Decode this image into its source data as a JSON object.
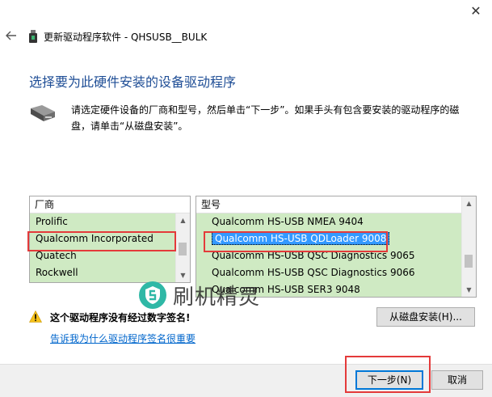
{
  "window": {
    "title": "更新驱动程序软件 - QHSUSB__BULK",
    "close_glyph": "✕"
  },
  "main": {
    "heading": "选择要为此硬件安装的设备驱动程序",
    "instruction": "请选定硬件设备的厂商和型号，然后单击“下一步”。如果手头有包含要安装的驱动程序的磁盘，请单击“从磁盘安装”。"
  },
  "manufacturers": {
    "header": "厂商",
    "items": [
      "Prolific",
      "Qualcomm Incorporated",
      "Quatech",
      "Rockwell"
    ]
  },
  "models": {
    "header": "型号",
    "items": [
      "Qualcomm HS-USB NMEA 9404",
      "Qualcomm HS-USB QDLoader 9008",
      "Qualcomm HS-USB QSC Diagnostics 9065",
      "Qualcomm HS-USB QSC Diagnostics 9066",
      "Qualcomm HS-USB SER3 9048"
    ]
  },
  "watermark": {
    "text": "刷机精灵"
  },
  "warning": {
    "text": "这个驱动程序没有经过数字签名!",
    "link": "告诉我为什么驱动程序签名很重要"
  },
  "buttons": {
    "have_disk": "从磁盘安装(H)...",
    "next": "下一步(N)",
    "cancel": "取消"
  },
  "colors": {
    "accent": "#3399ff",
    "list_bg": "#cfeac3",
    "highlight_box": "#e43a3a",
    "heading": "#1f4e96",
    "link": "#0066cc"
  }
}
